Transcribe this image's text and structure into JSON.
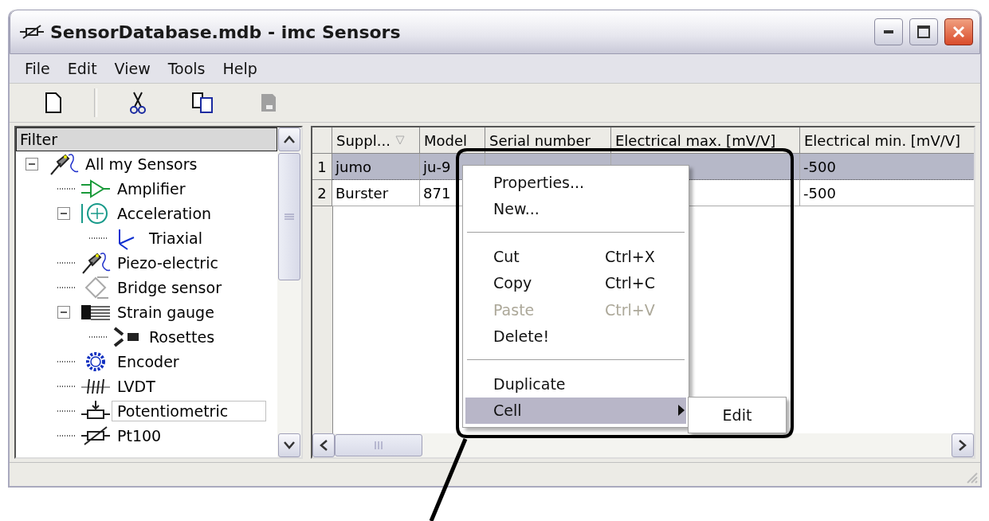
{
  "window": {
    "title": "SensorDatabase.mdb - imc Sensors"
  },
  "menu": [
    "File",
    "Edit",
    "View",
    "Tools",
    "Help"
  ],
  "toolbar": [
    {
      "kind": "new",
      "disabled": false
    },
    {
      "kind": "separator"
    },
    {
      "kind": "cut",
      "disabled": false
    },
    {
      "kind": "copy",
      "disabled": false
    },
    {
      "kind": "save",
      "disabled": true
    }
  ],
  "filter": {
    "title": "Filter"
  },
  "tree": [
    {
      "label": "All my Sensors",
      "expanded": true,
      "selected": false,
      "children": [
        {
          "label": "Amplifier",
          "selected": false
        },
        {
          "label": "Acceleration",
          "expanded": true,
          "selected": false,
          "children": [
            {
              "label": "Triaxial",
              "selected": false
            }
          ]
        },
        {
          "label": "Piezo-electric",
          "selected": false
        },
        {
          "label": "Bridge sensor",
          "selected": false
        },
        {
          "label": "Strain gauge",
          "expanded": true,
          "selected": false,
          "children": [
            {
              "label": "Rosettes",
              "selected": false
            }
          ]
        },
        {
          "label": "Encoder",
          "selected": false
        },
        {
          "label": "LVDT",
          "selected": false
        },
        {
          "label": "Potentiometric",
          "selected": true
        },
        {
          "label": "Pt100",
          "selected": false
        }
      ]
    }
  ],
  "table": {
    "columns": [
      {
        "label": "Suppl...",
        "sorted": true
      },
      {
        "label": "Model",
        "sorted": false
      },
      {
        "label": "Serial number",
        "sorted": false
      },
      {
        "label": "Electrical max. [mV/V]",
        "sorted": false
      },
      {
        "label": "Electrical min. [mV/V]",
        "sorted": false
      }
    ],
    "rows": [
      {
        "number": "1",
        "selected": true,
        "cells": [
          "jumo",
          "ju-9",
          "",
          "",
          "-500"
        ]
      },
      {
        "number": "2",
        "selected": false,
        "cells": [
          "Burster",
          "871",
          "",
          "",
          "-500"
        ]
      }
    ]
  },
  "context_menu": {
    "items": [
      {
        "kind": "item",
        "label": "Properties...",
        "disabled": false,
        "selected": false
      },
      {
        "kind": "item",
        "label": "New...",
        "disabled": false,
        "selected": false
      },
      {
        "kind": "separator"
      },
      {
        "kind": "item",
        "label": "Cut",
        "shortcut": "Ctrl+X",
        "disabled": false,
        "selected": false
      },
      {
        "kind": "item",
        "label": "Copy",
        "shortcut": "Ctrl+C",
        "disabled": false,
        "selected": false
      },
      {
        "kind": "item",
        "label": "Paste",
        "shortcut": "Ctrl+V",
        "disabled": true,
        "selected": false
      },
      {
        "kind": "item",
        "label": "Delete!",
        "disabled": false,
        "selected": false
      },
      {
        "kind": "separator"
      },
      {
        "kind": "item",
        "label": "Duplicate",
        "disabled": false,
        "selected": false
      },
      {
        "kind": "submenu",
        "label": "Cell",
        "disabled": false,
        "selected": true,
        "submenu": [
          "Edit"
        ]
      }
    ]
  }
}
